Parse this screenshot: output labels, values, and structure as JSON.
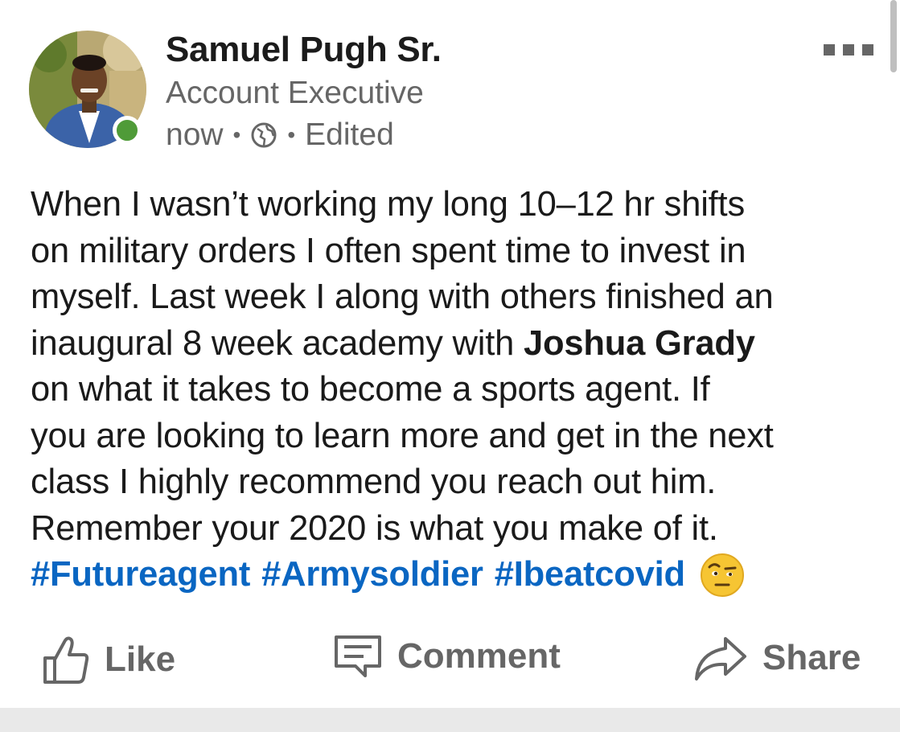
{
  "post": {
    "author": {
      "name": "Samuel Pugh Sr.",
      "headline": "Account Executive",
      "online": true,
      "presence_color": "#4f9b38"
    },
    "meta": {
      "time": "now",
      "separator": "•",
      "visibility_icon": "globe-icon",
      "edited": "Edited"
    },
    "more_icon": "more-horizontal-icon",
    "body": {
      "line1": "When I wasn’t working my long 10–12 hr shifts",
      "line2": "on military orders I often spent time to invest in",
      "line3": "myself. Last week I along with others finished an",
      "line4_pre": "inaugural 8 week academy with ",
      "mention": "Joshua Grady",
      "line5": "on what it takes to become a sports agent. If",
      "line6": "you are looking to learn more and get in the next",
      "line7": "class I highly recommend you reach out him.",
      "line8": "Remember your 2020 is what you make of it.",
      "hashtags": [
        "#Futureagent",
        "#Armysoldier",
        "#Ibeatcovid"
      ],
      "emoji_icon": "face-with-raised-eyebrow-icon"
    },
    "actions": {
      "like": "Like",
      "comment": "Comment",
      "share": "Share"
    }
  },
  "colors": {
    "hashtag": "#0a66c2",
    "secondary_text": "#666666",
    "primary_text": "#1a1a1a"
  }
}
